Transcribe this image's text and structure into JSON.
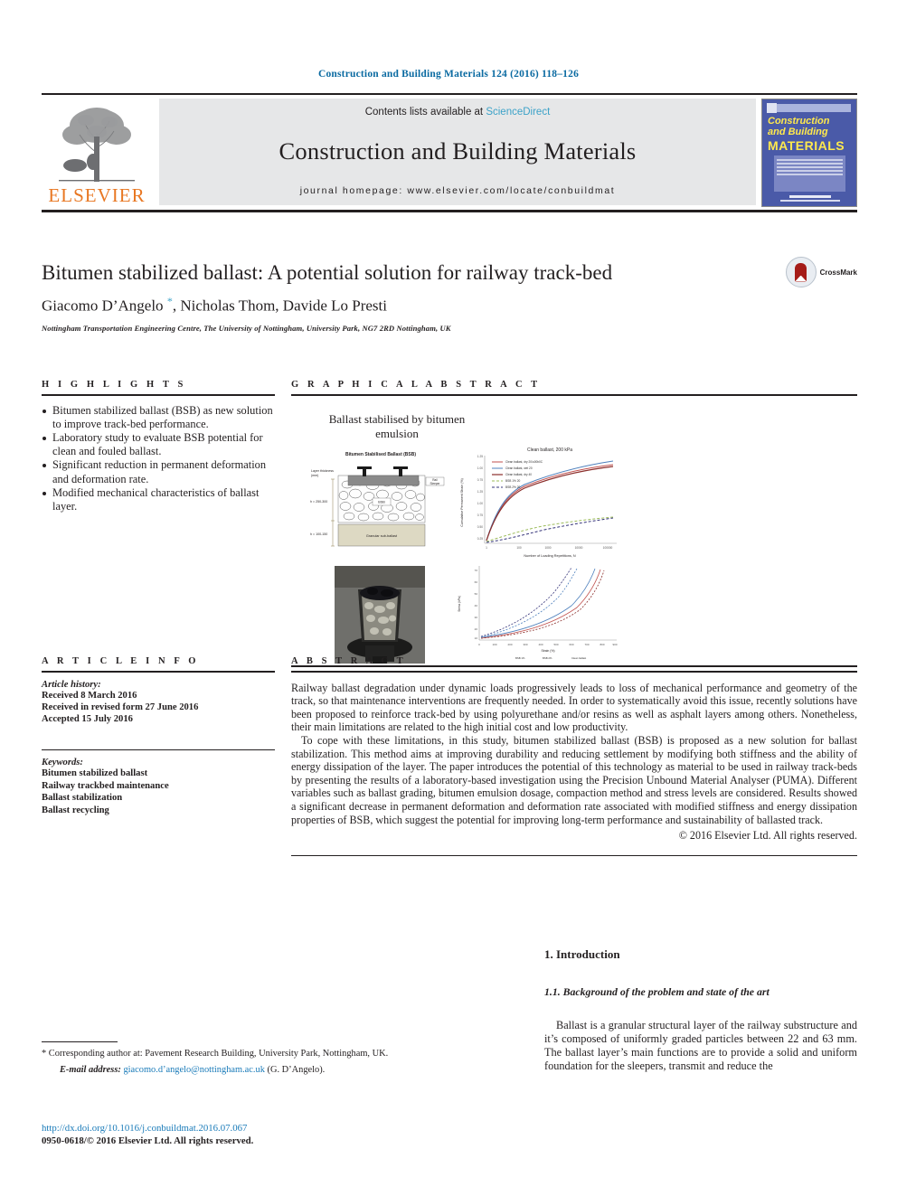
{
  "running_head": "Construction and Building Materials 124 (2016) 118–126",
  "masthead": {
    "contents_prefix": "Contents lists available at ",
    "sciencedirect": "ScienceDirect",
    "journal_name": "Construction and Building Materials",
    "homepage": "journal homepage: www.elsevier.com/locate/conbuildmat",
    "publisher": "ELSEVIER",
    "cover": {
      "line1": "Construction",
      "line2": "and Building",
      "line3": "MATERIALS"
    }
  },
  "title": "Bitumen stabilized ballast: A potential solution for railway track-bed",
  "authors": "Giacomo D’Angelo *, Nicholas Thom, Davide Lo Presti",
  "affiliation": "Nottingham Transportation Engineering Centre, The University of Nottingham, University Park, NG7 2RD Nottingham, UK",
  "crossmark_label": "CrossMark",
  "highlights": {
    "heading": "H I G H L I G H T S",
    "items": [
      "Bitumen stabilized ballast (BSB) as new solution to improve track-bed performance.",
      "Laboratory study to evaluate BSB potential for clean and fouled ballast.",
      "Significant reduction in permanent deformation and deformation rate.",
      "Modified mechanical characteristics of ballast layer."
    ]
  },
  "graphical_abstract": {
    "heading": "G R A P H I C A L   A B S T R A C T",
    "figure_title": "Ballast stabilised by bitumen emulsion",
    "diagram": {
      "caption": "Bitumen Stabilised Ballast (BSB)",
      "axis_label": "Layer thickness (mm)",
      "sleeper_label": "Sleeper",
      "bsb_label": "BSB",
      "subballast_label": "Granular sub-ballast",
      "thickness_top": "h = 250-300",
      "thickness_bottom": "h = 100-150"
    },
    "chart1": {
      "title": "Clean ballast, 200 kPa",
      "xlabel": "Number of Loading Repetitions, N",
      "ylabel": "Cumulative Permanent Strain (%)",
      "legend": [
        "Clean ballast, dry 20°C",
        "Clean ballast, wet 20°C",
        "Clean ballast, dry 40°C",
        "BSB 1% 20°C",
        "BSB 2% 20°C"
      ]
    },
    "chart2": {
      "xlabel": "Strain (%)",
      "ylabel": "Stress (kPa)"
    }
  },
  "article_info": {
    "heading": "A R T I C L E   I N F O",
    "history_label": "Article history:",
    "history": [
      "Received 8 March 2016",
      "Received in revised form 27 June 2016",
      "Accepted 15 July 2016"
    ],
    "keywords_label": "Keywords:",
    "keywords": [
      "Bitumen stabilized ballast",
      "Railway trackbed maintenance",
      "Ballast stabilization",
      "Ballast recycling"
    ]
  },
  "abstract": {
    "heading": "A B S T R A C T",
    "paragraphs": [
      "Railway ballast degradation under dynamic loads progressively leads to loss of mechanical performance and geometry of the track, so that maintenance interventions are frequently needed. In order to systematically avoid this issue, recently solutions have been proposed to reinforce track-bed by using polyurethane and/or resins as well as asphalt layers among others. Nonetheless, their main limitations are related to the high initial cost and low productivity.",
      "To cope with these limitations, in this study, bitumen stabilized ballast (BSB) is proposed as a new solution for ballast stabilization. This method aims at improving durability and reducing settlement by modifying both stiffness and the ability of energy dissipation of the layer. The paper introduces the potential of this technology as material to be used in railway track-beds by presenting the results of a laboratory-based investigation using the Precision Unbound Material Analyser (PUMA). Different variables such as ballast grading, bitumen emulsion dosage, compaction method and stress levels are considered. Results showed a significant decrease in permanent deformation and deformation rate associated with modified stiffness and energy dissipation properties of BSB, which suggest the potential for improving long-term performance and sustainability of ballasted track."
    ],
    "copyright": "© 2016 Elsevier Ltd. All rights reserved."
  },
  "introduction": {
    "section_number_title": "1. Introduction",
    "subsection": "1.1. Background of the problem and state of the art",
    "paragraph": "Ballast is a granular structural layer of the railway substructure and it’s composed of uniformly graded particles between 22 and 63 mm. The ballast layer’s main functions are to provide a solid and uniform foundation for the sleepers, transmit and reduce the"
  },
  "footnotes": {
    "corresponding": "* Corresponding author at: Pavement Research Building, University Park, Nottingham, UK.",
    "email_label": "E-mail address:",
    "email": "giacomo.d’angelo@nottingham.ac.uk",
    "email_suffix": "(G. D’Angelo).",
    "doi": "http://dx.doi.org/10.1016/j.conbuildmat.2016.07.067",
    "issn": "0950-0618/© 2016 Elsevier Ltd. All rights reserved."
  },
  "colors": {
    "link_blue": "#1a7bb9",
    "sciencedirect_blue": "#3ca2c8",
    "elsevier_orange": "#e87722",
    "rule_black": "#231f20",
    "cover_blue": "#4a5aa8",
    "cover_yellow": "#ffe94d"
  }
}
